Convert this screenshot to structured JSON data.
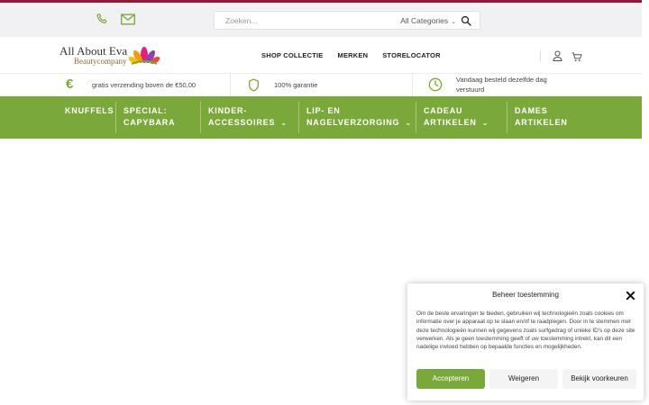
{
  "topbar": {
    "icons": [
      "phone-icon",
      "mail-icon"
    ],
    "search": {
      "placeholder": "Zoeken...",
      "category_label": "All Categories",
      "button_icon": "search-icon"
    }
  },
  "header": {
    "logo": {
      "title": "All About Eva",
      "subtitle": "Beautycompany"
    },
    "nav": [
      "SHOP COLLECTIE",
      "MERKEN",
      "STORELOCATOR"
    ],
    "icons": [
      "user-icon",
      "cart-icon"
    ]
  },
  "usps": [
    {
      "icon": "euro-icon",
      "text": "gratis verzending boven de €50,00"
    },
    {
      "icon": "shield-icon",
      "text": "100% garantie"
    },
    {
      "icon": "clock-icon",
      "text_line1": "Vandaag besteld dezelfde dag",
      "text_line2": "verstuurd"
    }
  ],
  "categories": [
    {
      "line1": "KNUFFELS",
      "line2": ""
    },
    {
      "line1": "SPECIAL:",
      "line2": "CAPYBARA"
    },
    {
      "line1": "KINDER-",
      "line2": "ACCESSOIRES"
    },
    {
      "line1": "LIP- EN",
      "line2": "NAGELVERZORGING"
    },
    {
      "line1": "CADEAU",
      "line2": "ARTIKELEN"
    },
    {
      "line1": "DAMES",
      "line2": "ARTIKELEN"
    }
  ],
  "cookie": {
    "title": "Beheer toestemming",
    "text": "Om de beste ervaringen te bieden, gebruiken wij technologieën zoals cookies om informatie over je apparaat op te slaan en/of te raadplegen. Door in te stemmen met deze technologieën kunnen wij gegevens zoals surfgedrag of unieke ID's op deze site verwerken. Als je geen toestemming geeft of uw toestemming intrekt, kan dit een nadelige invloed hebben op bepaalde functies en mogelijkheden.",
    "accept": "Accepteren",
    "deny": "Weigeren",
    "prefs": "Bekijk voorkeuren"
  },
  "colors": {
    "brand_green": "#7ba83a",
    "top_accent": "#8d1a3a",
    "topbar_bg": "#f1f1f3"
  }
}
